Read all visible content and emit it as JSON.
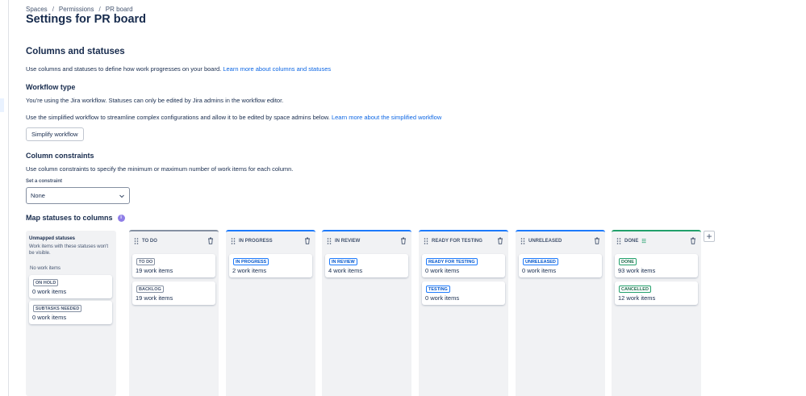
{
  "breadcrumb": [
    "Spaces",
    "Permissions",
    "PR board"
  ],
  "page_title": "Settings for PR board",
  "section_title": "Columns and statuses",
  "intro": {
    "text": "Use columns and statuses to define how work progresses on your board.",
    "link": "Learn more about columns and statuses"
  },
  "workflow": {
    "title": "Workflow type",
    "line1": "You're using the Jira workflow. Statuses can only be edited by Jira admins in the workflow editor.",
    "line2": "Use the simplified workflow to streamline complex configurations and allow it to be edited by space admins below.",
    "line2_link": "Learn more about the simplified workflow",
    "button": "Simplify workflow"
  },
  "constraints": {
    "title": "Column constraints",
    "text": "Use column constraints to specify the minimum or maximum number of work items for each column.",
    "label": "Set a constraint",
    "value": "None"
  },
  "map_title": "Map statuses to columns",
  "info_icon_glyph": "i",
  "unmapped": {
    "title": "Unmapped statuses",
    "desc": "Work items with these statuses won't be visible.",
    "no_items": "No work items",
    "cards": [
      {
        "status": "ON HOLD",
        "count": "0 work items"
      },
      {
        "status": "SUBTASKS NEEDED",
        "count": "0 work items"
      }
    ]
  },
  "columns": [
    {
      "name": "TO DO",
      "color": "#8590a2",
      "cards": [
        {
          "status": "TO DO",
          "count": "19 work items"
        },
        {
          "status": "BACKLOG",
          "count": "19 work items"
        }
      ]
    },
    {
      "name": "IN PROGRESS",
      "color": "#1d7afc",
      "cards": [
        {
          "status": "IN PROGRESS",
          "count": "2 work items"
        }
      ]
    },
    {
      "name": "IN REVIEW",
      "color": "#1d7afc",
      "cards": [
        {
          "status": "IN REVIEW",
          "count": "4 work items"
        }
      ]
    },
    {
      "name": "READY FOR TESTING",
      "color": "#1d7afc",
      "cards": [
        {
          "status": "READY FOR TESTING",
          "count": "0 work items"
        },
        {
          "status": "TESTING",
          "count": "0 work items"
        }
      ]
    },
    {
      "name": "UNRELEASED",
      "color": "#1d7afc",
      "cards": [
        {
          "status": "UNRELEASED",
          "count": "0 work items"
        }
      ]
    },
    {
      "name": "DONE",
      "color": "#22a06b",
      "done_glyph": "☷",
      "cards": [
        {
          "status": "DONE",
          "count": "93 work items"
        },
        {
          "status": "CANCELLED",
          "count": "12 work items"
        }
      ]
    }
  ],
  "add_column_glyph": "+",
  "colors": {
    "link": "#0c66e4",
    "blue_top": "#1d7afc",
    "green_top": "#22a06b",
    "gray_top": "#8590a2"
  }
}
